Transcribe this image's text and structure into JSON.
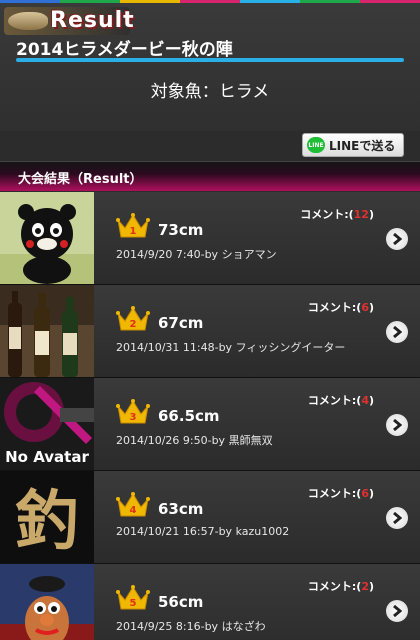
{
  "app": {
    "logo_text": "Result",
    "event_title": "2014ヒラメダービー秋の陣",
    "target_fish": "対象魚：ヒラメ",
    "line_button": "LINEで送る",
    "line_icon_text": "LINE",
    "section_title": "大会結果（Result）"
  },
  "colors": {
    "accent_bar": "#2ab0e6",
    "section_gradient_end": "#b0105e",
    "comment_count": "#e03030",
    "crown": "#f0b800"
  },
  "results": [
    {
      "rank": "1",
      "size": "73cm",
      "date": "2014/9/20 7:40",
      "user": "ショアマン",
      "comment_label": "コメント:(",
      "comment_count": "12",
      "comment_close": ")",
      "thumb": "kumamon-plush"
    },
    {
      "rank": "2",
      "size": "67cm",
      "date": "2014/10/31 11:48",
      "user": "フィッシングイーター",
      "comment_label": "コメント:(",
      "comment_count": "6",
      "comment_close": ")",
      "thumb": "sake-bottles"
    },
    {
      "rank": "3",
      "size": "66.5cm",
      "date": "2014/10/26 9:50",
      "user": "黒師無双",
      "comment_label": "コメント:(",
      "comment_count": "4",
      "comment_close": ")",
      "thumb": "no-avatar",
      "thumb_text": "No Avatar"
    },
    {
      "rank": "4",
      "size": "63cm",
      "date": "2014/10/21 16:57",
      "user": "kazu1002",
      "comment_label": "コメント:(",
      "comment_count": "6",
      "comment_close": ")",
      "thumb": "kanji-fish",
      "thumb_text": "釣"
    },
    {
      "rank": "5",
      "size": "56cm",
      "date": "2014/9/25 8:16",
      "user": "はなざわ",
      "comment_label": "コメント:(",
      "comment_count": "2",
      "comment_close": ")",
      "thumb": "toy-figure"
    }
  ],
  "by_label": "-by "
}
